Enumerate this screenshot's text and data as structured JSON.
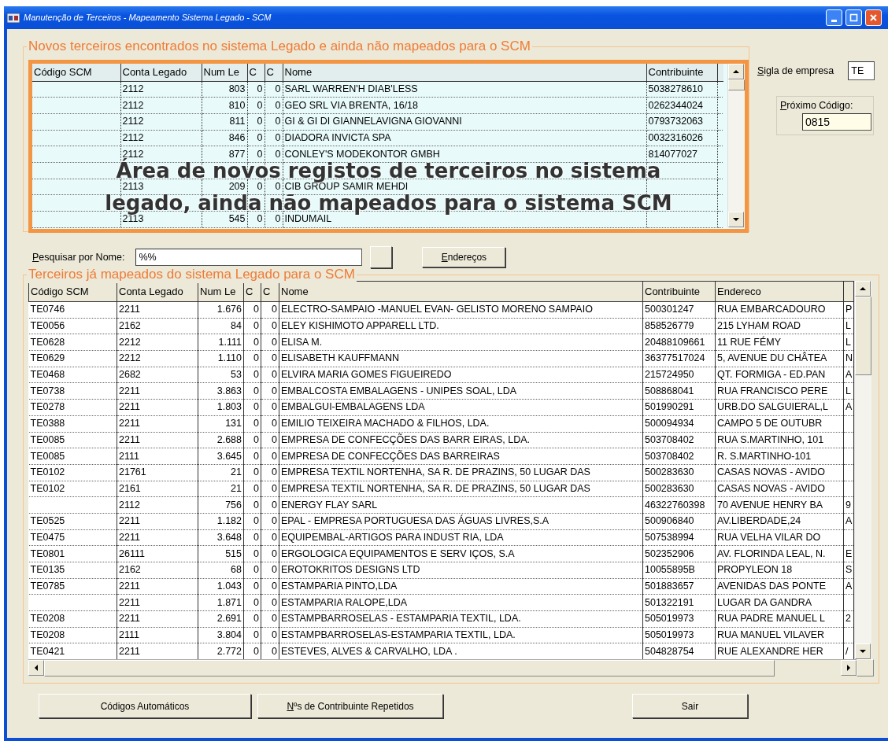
{
  "window": {
    "title": "Manutenção de Terceiros - Mapeamento Sistema Legado - SCM"
  },
  "new_group": {
    "title": "Novos terceiros encontrados no sistema Legado e ainda não mapeados para o SCM",
    "table": {
      "columns": [
        {
          "label": "Código SCM",
          "kind": "text"
        },
        {
          "label": "Conta Legado",
          "kind": "text"
        },
        {
          "label": "Num Le",
          "kind": "number"
        },
        {
          "label": "C",
          "kind": "number"
        },
        {
          "label": "C",
          "kind": "number"
        },
        {
          "label": "Nome",
          "kind": "text"
        },
        {
          "label": "Contribuinte",
          "kind": "text"
        }
      ],
      "rows": [
        {
          "cells": [
            null,
            "2112",
            "803",
            "0",
            "0",
            "SARL WARREN'H DIAB'LESS",
            "5038278610"
          ]
        },
        {
          "cells": [
            null,
            "2112",
            "810",
            "0",
            "0",
            "GEO SRL VIA BRENTA, 16/18",
            "0262344024"
          ]
        },
        {
          "cells": [
            null,
            "2112",
            "811",
            "0",
            "0",
            "GI & GI DI GIANNELAVIGNA GIOVANNI",
            "0793732063"
          ]
        },
        {
          "cells": [
            null,
            "2112",
            "846",
            "0",
            "0",
            "DIADORA INVICTA SPA",
            "0032316026"
          ]
        },
        {
          "cells": [
            null,
            "2112",
            "877",
            "0",
            "0",
            "CONLEY'S MODEKONTOR GMBH",
            "814077027"
          ]
        },
        {
          "cells": [
            null,
            null,
            null,
            null,
            null,
            null,
            null
          ]
        },
        {
          "cells": [
            null,
            "2113",
            "209",
            "0",
            "0",
            "CIB GROUP SAMIR MEHDI",
            null
          ]
        },
        {
          "cells": [
            null,
            null,
            null,
            null,
            null,
            null,
            null
          ]
        },
        {
          "cells": [
            null,
            "2113",
            "545",
            "0",
            "0",
            "INDUMAIL",
            null
          ]
        }
      ]
    },
    "callout": {
      "lines": [
        "Área de novos registos de terceiros no sistema",
        "legado, ainda não mapeados para o sistema SCM"
      ]
    }
  },
  "company_code": {
    "label": "Sigla de empresa",
    "mnemonic": true,
    "value": "TE"
  },
  "next_code": {
    "label": "Próximo Código:",
    "mnemonic": true,
    "value": "0815"
  },
  "search": {
    "label": "Pesquisar por Nome:",
    "mnemonic": true,
    "value": "%%"
  },
  "addresses_button": {
    "label": "Endereços",
    "mnemonic": true
  },
  "mapped_group": {
    "title": "Terceiros já mapeados do sistema Legado para o SCM",
    "table": {
      "columns": [
        {
          "label": "Código SCM",
          "kind": "text"
        },
        {
          "label": "Conta Legado",
          "kind": "text"
        },
        {
          "label": "Num Le",
          "kind": "number"
        },
        {
          "label": "C",
          "kind": "number"
        },
        {
          "label": "C",
          "kind": "number"
        },
        {
          "label": "Nome",
          "kind": "text"
        },
        {
          "label": "Contribuinte",
          "kind": "text"
        },
        {
          "label": "Endereco",
          "kind": "text"
        },
        {
          "kind": "text"
        }
      ],
      "rows": [
        {
          "cells": [
            "TE0746",
            "2211",
            "1.676",
            "0",
            "0",
            "ELECTRO-SAMPAIO -MANUEL EVAN- GELISTO MORENO SAMPAIO",
            "500301247",
            "RUA EMBARCADOURO",
            "P"
          ]
        },
        {
          "cells": [
            "TE0056",
            "2162",
            "84",
            "0",
            "0",
            "ELEY KISHIMOTO APPARELL LTD.",
            "858526779",
            "215 LYHAM ROAD",
            "L"
          ]
        },
        {
          "cells": [
            "TE0628",
            "2212",
            "1.111",
            "0",
            "0",
            "ELISA M.",
            "20488109661",
            "11 RUE FÉMY",
            "L"
          ]
        },
        {
          "cells": [
            "TE0629",
            "2212",
            "1.110",
            "0",
            "0",
            "ELISABETH KAUFFMANN",
            "36377517024",
            "5, AVENUE DU CHÂTEA",
            "N"
          ]
        },
        {
          "cells": [
            "TE0468",
            "2682",
            "53",
            "0",
            "0",
            "ELVIRA MARIA GOMES FIGUEIREDO",
            "215724950",
            "QT. FORMIGA - ED.PAN",
            "A"
          ]
        },
        {
          "cells": [
            "TE0738",
            "2211",
            "3.863",
            "0",
            "0",
            "EMBALCOSTA EMBALAGENS - UNIPES SOAL, LDA",
            "508868041",
            "RUA FRANCISCO PERE",
            "L"
          ]
        },
        {
          "cells": [
            "TE0278",
            "2211",
            "1.803",
            "0",
            "0",
            "EMBALGUI-EMBALAGENS LDA",
            "501990291",
            "URB.DO SALGUIERAL,L",
            "A"
          ]
        },
        {
          "cells": [
            "TE0388",
            "2211",
            "131",
            "0",
            "0",
            "EMILIO TEIXEIRA MACHADO & FILHOS, LDA.",
            "500094934",
            "CAMPO 5 DE OUTUBR",
            null
          ]
        },
        {
          "cells": [
            "TE0085",
            "2211",
            "2.688",
            "0",
            "0",
            "EMPRESA DE CONFECÇÕES DAS BARR EIRAS, LDA.",
            "503708402",
            "RUA S.MARTINHO, 101",
            null
          ]
        },
        {
          "cells": [
            "TE0085",
            "2111",
            "3.645",
            "0",
            "0",
            "EMPRESA DE CONFECÇÕES DAS BARREIRAS",
            "503708402",
            "R. S.MARTINHO-101",
            null
          ]
        },
        {
          "cells": [
            "TE0102",
            "21761",
            "21",
            "0",
            "0",
            "EMPRESA TEXTIL NORTENHA, SA R. DE PRAZINS, 50 LUGAR DAS",
            "500283630",
            "CASAS NOVAS - AVIDO",
            null
          ]
        },
        {
          "cells": [
            "TE0102",
            "2161",
            "21",
            "0",
            "0",
            "EMPRESA TEXTIL NORTENHA, SA R. DE PRAZINS, 50 LUGAR DAS",
            "500283630",
            "CASAS NOVAS - AVIDO",
            null
          ]
        },
        {
          "cells": [
            null,
            "2112",
            "756",
            "0",
            "0",
            "ENERGY FLAY SARL",
            "46322760398",
            "70 AVENUE HENRY BA",
            "9"
          ]
        },
        {
          "cells": [
            "TE0525",
            "2211",
            "1.182",
            "0",
            "0",
            "EPAL - EMPRESA PORTUGUESA DAS ÁGUAS LIVRES,S.A",
            "500906840",
            "AV.LIBERDADE,24",
            "A"
          ]
        },
        {
          "cells": [
            "TE0475",
            "2211",
            "3.648",
            "0",
            "0",
            "EQUIPEMBAL-ARTIGOS PARA INDUST RIA, LDA",
            "507538994",
            "RUA VELHA VILAR DO",
            null
          ]
        },
        {
          "cells": [
            "TE0801",
            "26111",
            "515",
            "0",
            "0",
            "ERGOLOGICA EQUIPAMENTOS E SERV IÇOS, S.A",
            "502352906",
            "AV. FLORINDA LEAL, N.",
            "E"
          ]
        },
        {
          "cells": [
            "TE0135",
            "2162",
            "68",
            "0",
            "0",
            "EROTOKRITOS DESIGNS LTD",
            "10055895B",
            "PROPYLEON 18",
            "S"
          ]
        },
        {
          "cells": [
            "TE0785",
            "2211",
            "1.043",
            "0",
            "0",
            "ESTAMPARIA PINTO,LDA",
            "501883657",
            "AVENIDAS DAS PONTE",
            "A"
          ]
        },
        {
          "cells": [
            null,
            "2211",
            "1.871",
            "0",
            "0",
            "ESTAMPARIA RALOPE,LDA",
            "501322191",
            "LUGAR DA GANDRA",
            null
          ]
        },
        {
          "cells": [
            "TE0208",
            "2211",
            "2.691",
            "0",
            "0",
            "ESTAMPBARROSELAS - ESTAMPARIA TEXTIL, LDA.",
            "505019973",
            "RUA PADRE MANUEL L",
            "2"
          ]
        },
        {
          "cells": [
            "TE0208",
            "2111",
            "3.804",
            "0",
            "0",
            "ESTAMPBARROSELAS-ESTAMPARIA TEXTIL, LDA.",
            "505019973",
            "RUA MANUEL VILAVER",
            null
          ]
        },
        {
          "cells": [
            "TE0421",
            "2211",
            "2.772",
            "0",
            "0",
            "ESTEVES, ALVES & CARVALHO, LDA .",
            "504828754",
            "RUE ALEXANDRE HER",
            "/"
          ]
        }
      ]
    }
  },
  "buttons": [
    {
      "label": "Códigos Automáticos",
      "mnemonic": false
    },
    {
      "label": "Nºs de Contribuinte Repetidos",
      "mnemonic": true
    },
    {
      "label": "Sair",
      "mnemonic": false
    }
  ]
}
